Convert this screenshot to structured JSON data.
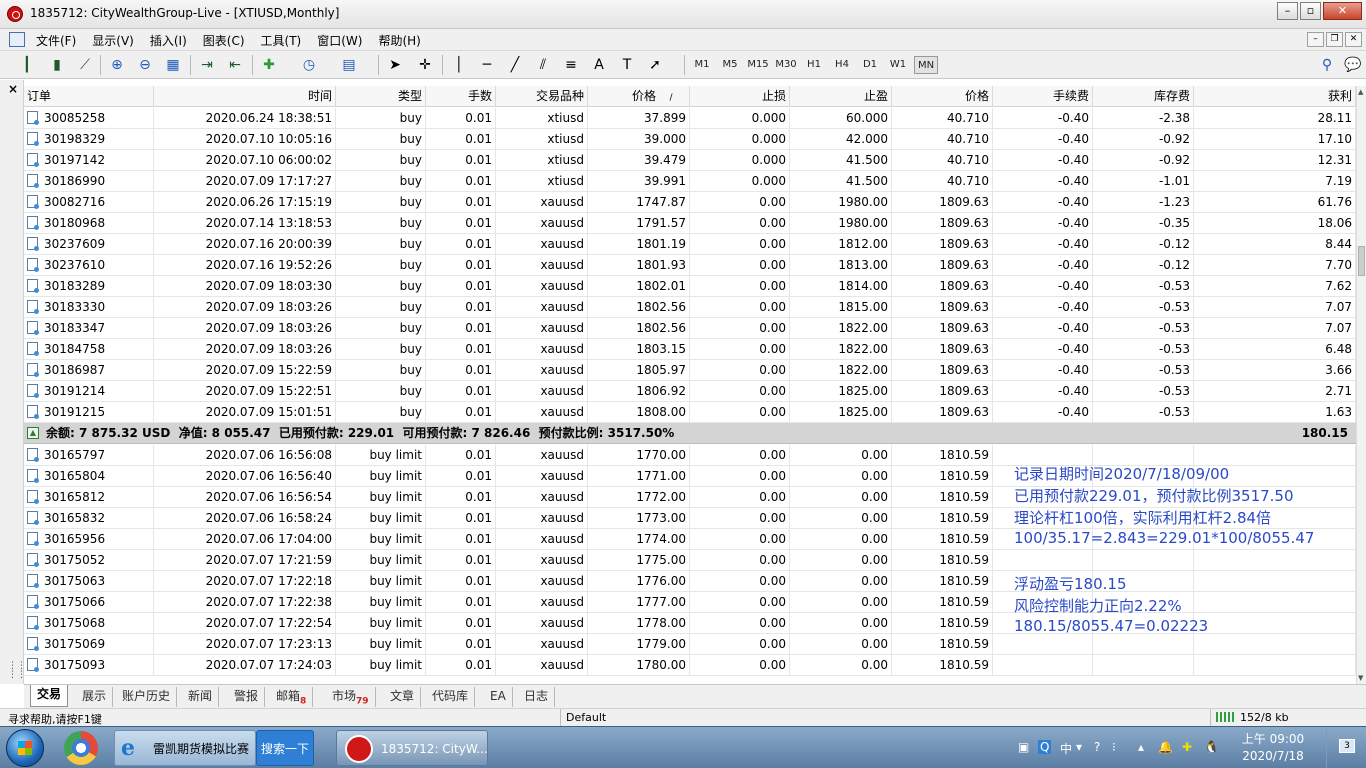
{
  "window": {
    "title": "1835712: CityWealthGroup-Live - [XTIUSD,Monthly]"
  },
  "menu": {
    "items": [
      "文件(F)",
      "显示(V)",
      "插入(I)",
      "图表(C)",
      "工具(T)",
      "窗口(W)",
      "帮助(H)"
    ]
  },
  "toolbar": {
    "timeframes": [
      "M1",
      "M5",
      "M15",
      "M30",
      "H1",
      "H4",
      "D1",
      "W1",
      "MN"
    ],
    "active_timeframe": "MN"
  },
  "table": {
    "headers": [
      "订单",
      "时间",
      "类型",
      "手数",
      "交易品种",
      "价格",
      "止损",
      "止盈",
      "价格",
      "手续费",
      "库存费",
      "获利"
    ],
    "sort_mark": "/",
    "open_orders": [
      [
        "30085258",
        "2020.06.24 18:38:51",
        "buy",
        "0.01",
        "xtiusd",
        "37.899",
        "0.000",
        "60.000",
        "40.710",
        "-0.40",
        "-2.38",
        "28.11"
      ],
      [
        "30198329",
        "2020.07.10 10:05:16",
        "buy",
        "0.01",
        "xtiusd",
        "39.000",
        "0.000",
        "42.000",
        "40.710",
        "-0.40",
        "-0.92",
        "17.10"
      ],
      [
        "30197142",
        "2020.07.10 06:00:02",
        "buy",
        "0.01",
        "xtiusd",
        "39.479",
        "0.000",
        "41.500",
        "40.710",
        "-0.40",
        "-0.92",
        "12.31"
      ],
      [
        "30186990",
        "2020.07.09 17:17:27",
        "buy",
        "0.01",
        "xtiusd",
        "39.991",
        "0.000",
        "41.500",
        "40.710",
        "-0.40",
        "-1.01",
        "7.19"
      ],
      [
        "30082716",
        "2020.06.26 17:15:19",
        "buy",
        "0.01",
        "xauusd",
        "1747.87",
        "0.00",
        "1980.00",
        "1809.63",
        "-0.40",
        "-1.23",
        "61.76"
      ],
      [
        "30180968",
        "2020.07.14 13:18:53",
        "buy",
        "0.01",
        "xauusd",
        "1791.57",
        "0.00",
        "1980.00",
        "1809.63",
        "-0.40",
        "-0.35",
        "18.06"
      ],
      [
        "30237609",
        "2020.07.16 20:00:39",
        "buy",
        "0.01",
        "xauusd",
        "1801.19",
        "0.00",
        "1812.00",
        "1809.63",
        "-0.40",
        "-0.12",
        "8.44"
      ],
      [
        "30237610",
        "2020.07.16 19:52:26",
        "buy",
        "0.01",
        "xauusd",
        "1801.93",
        "0.00",
        "1813.00",
        "1809.63",
        "-0.40",
        "-0.12",
        "7.70"
      ],
      [
        "30183289",
        "2020.07.09 18:03:30",
        "buy",
        "0.01",
        "xauusd",
        "1802.01",
        "0.00",
        "1814.00",
        "1809.63",
        "-0.40",
        "-0.53",
        "7.62"
      ],
      [
        "30183330",
        "2020.07.09 18:03:26",
        "buy",
        "0.01",
        "xauusd",
        "1802.56",
        "0.00",
        "1815.00",
        "1809.63",
        "-0.40",
        "-0.53",
        "7.07"
      ],
      [
        "30183347",
        "2020.07.09 18:03:26",
        "buy",
        "0.01",
        "xauusd",
        "1802.56",
        "0.00",
        "1822.00",
        "1809.63",
        "-0.40",
        "-0.53",
        "7.07"
      ],
      [
        "30184758",
        "2020.07.09 18:03:26",
        "buy",
        "0.01",
        "xauusd",
        "1803.15",
        "0.00",
        "1822.00",
        "1809.63",
        "-0.40",
        "-0.53",
        "6.48"
      ],
      [
        "30186987",
        "2020.07.09 15:22:59",
        "buy",
        "0.01",
        "xauusd",
        "1805.97",
        "0.00",
        "1822.00",
        "1809.63",
        "-0.40",
        "-0.53",
        "3.66"
      ],
      [
        "30191214",
        "2020.07.09 15:22:51",
        "buy",
        "0.01",
        "xauusd",
        "1806.92",
        "0.00",
        "1825.00",
        "1809.63",
        "-0.40",
        "-0.53",
        "2.71"
      ],
      [
        "30191215",
        "2020.07.09 15:01:51",
        "buy",
        "0.01",
        "xauusd",
        "1808.00",
        "0.00",
        "1825.00",
        "1809.63",
        "-0.40",
        "-0.53",
        "1.63"
      ]
    ],
    "summary": {
      "text": "余额: 7 875.32 USD  净值: 8 055.47  已用预付款: 229.01  可用预付款: 7 826.46  预付款比例: 3517.50%",
      "profit": "180.15"
    },
    "pending_orders": [
      [
        "30165797",
        "2020.07.06 16:56:08",
        "buy limit",
        "0.01",
        "xauusd",
        "1770.00",
        "0.00",
        "0.00",
        "1810.59"
      ],
      [
        "30165804",
        "2020.07.06 16:56:40",
        "buy limit",
        "0.01",
        "xauusd",
        "1771.00",
        "0.00",
        "0.00",
        "1810.59"
      ],
      [
        "30165812",
        "2020.07.06 16:56:54",
        "buy limit",
        "0.01",
        "xauusd",
        "1772.00",
        "0.00",
        "0.00",
        "1810.59"
      ],
      [
        "30165832",
        "2020.07.06 16:58:24",
        "buy limit",
        "0.01",
        "xauusd",
        "1773.00",
        "0.00",
        "0.00",
        "1810.59"
      ],
      [
        "30165956",
        "2020.07.06 17:04:00",
        "buy limit",
        "0.01",
        "xauusd",
        "1774.00",
        "0.00",
        "0.00",
        "1810.59"
      ],
      [
        "30175052",
        "2020.07.07 17:21:59",
        "buy limit",
        "0.01",
        "xauusd",
        "1775.00",
        "0.00",
        "0.00",
        "1810.59"
      ],
      [
        "30175063",
        "2020.07.07 17:22:18",
        "buy limit",
        "0.01",
        "xauusd",
        "1776.00",
        "0.00",
        "0.00",
        "1810.59"
      ],
      [
        "30175066",
        "2020.07.07 17:22:38",
        "buy limit",
        "0.01",
        "xauusd",
        "1777.00",
        "0.00",
        "0.00",
        "1810.59"
      ],
      [
        "30175068",
        "2020.07.07 17:22:54",
        "buy limit",
        "0.01",
        "xauusd",
        "1778.00",
        "0.00",
        "0.00",
        "1810.59"
      ],
      [
        "30175069",
        "2020.07.07 17:23:13",
        "buy limit",
        "0.01",
        "xauusd",
        "1779.00",
        "0.00",
        "0.00",
        "1810.59"
      ],
      [
        "30175093",
        "2020.07.07 17:24:03",
        "buy limit",
        "0.01",
        "xauusd",
        "1780.00",
        "0.00",
        "0.00",
        "1810.59"
      ]
    ]
  },
  "annotations": [
    "记录日期时间2020/7/18/09/00",
    "已用预付款229.01，预付款比例3517.50",
    "理论杆杠100倍，实际利用杠杆2.84倍",
    "100/35.17=2.843=229.01*100/8055.47",
    "浮动盈亏180.15",
    "风险控制能力正向2.22%",
    "180.15/8055.47=0.02223"
  ],
  "terminal_tabs": [
    {
      "label": "交易",
      "badge": "",
      "active": true
    },
    {
      "label": "展示",
      "badge": ""
    },
    {
      "label": "账户历史",
      "badge": ""
    },
    {
      "label": "新闻",
      "badge": ""
    },
    {
      "label": "警报",
      "badge": ""
    },
    {
      "label": "邮箱",
      "badge": "8"
    },
    {
      "label": "市场",
      "badge": "79"
    },
    {
      "label": "文章",
      "badge": ""
    },
    {
      "label": "代码库",
      "badge": ""
    },
    {
      "label": "EA",
      "badge": ""
    },
    {
      "label": "日志",
      "badge": ""
    }
  ],
  "status_bar": {
    "help": "寻求帮助,请按F1键",
    "profile": "Default",
    "traffic": "152/8 kb"
  },
  "taskbar": {
    "ie_task": "雷凯期货模拟比赛",
    "search_button": "搜索一下",
    "mt4_task": "1835712: CityW...",
    "tray_ime": "中",
    "clock_time": "上午 09:00",
    "clock_date": "2020/7/18",
    "desktop_badge": "3"
  },
  "colors": {
    "annotation": "#2a49c7",
    "summary_row": "#d4d4d4",
    "badge": "#d42020"
  }
}
